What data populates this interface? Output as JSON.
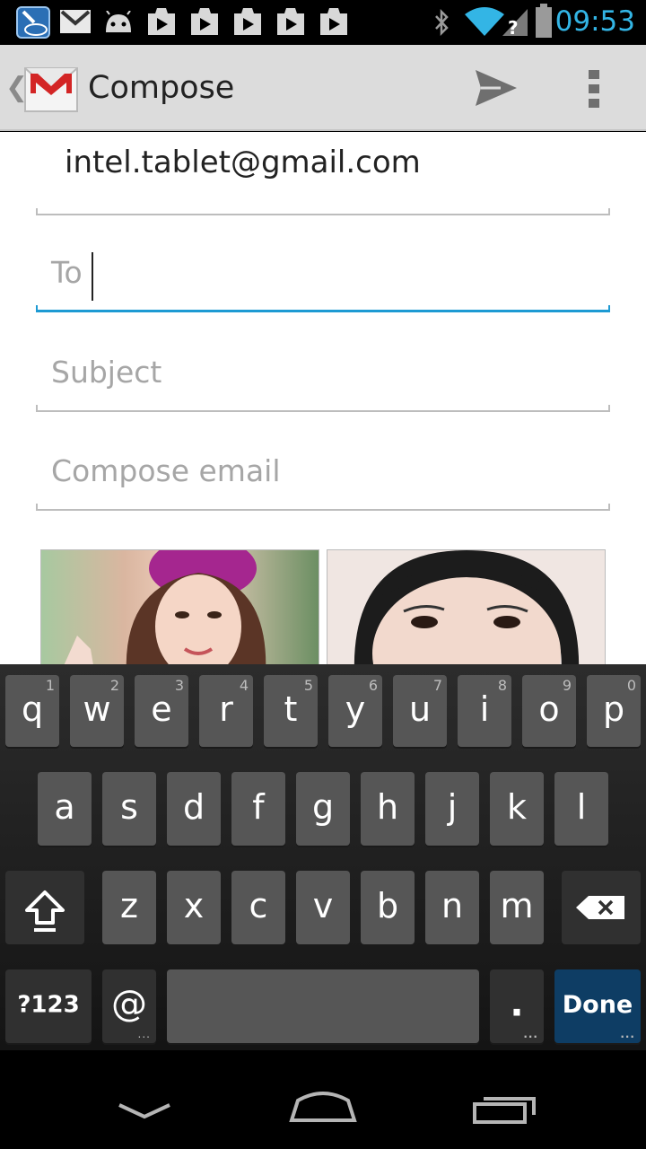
{
  "status_bar": {
    "time": "09:53",
    "icons": [
      "intel-app-icon",
      "gmail-icon",
      "android-icon",
      "play-store-icon",
      "play-store-icon",
      "play-store-icon",
      "play-store-icon",
      "play-store-icon",
      "bluetooth-icon",
      "wifi-icon",
      "no-signal-icon",
      "battery-icon"
    ],
    "accent_color": "#33b5e5"
  },
  "action_bar": {
    "title": "Compose",
    "app_icon": "gmail-logo-icon",
    "send_icon": "send-icon",
    "menu_icon": "overflow-menu-icon"
  },
  "compose": {
    "from": "intel.tablet@gmail.com",
    "to_placeholder": "To",
    "to_value": "",
    "subject_placeholder": "Subject",
    "body_placeholder": "Compose email",
    "focus_color": "#1d9ad3",
    "attachments": [
      "photo-attachment",
      "photo-attachment"
    ]
  },
  "keyboard": {
    "row1": [
      {
        "key": "q",
        "hint": "1"
      },
      {
        "key": "w",
        "hint": "2"
      },
      {
        "key": "e",
        "hint": "3"
      },
      {
        "key": "r",
        "hint": "4"
      },
      {
        "key": "t",
        "hint": "5"
      },
      {
        "key": "y",
        "hint": "6"
      },
      {
        "key": "u",
        "hint": "7"
      },
      {
        "key": "i",
        "hint": "8"
      },
      {
        "key": "o",
        "hint": "9"
      },
      {
        "key": "p",
        "hint": "0"
      }
    ],
    "row2": [
      "a",
      "s",
      "d",
      "f",
      "g",
      "h",
      "j",
      "k",
      "l"
    ],
    "row3": [
      "z",
      "x",
      "c",
      "v",
      "b",
      "n",
      "m"
    ],
    "symbols_label": "?123",
    "at_label": "@",
    "period_label": ".",
    "done_label": "Done",
    "shift_icon": "shift-icon",
    "delete_icon": "backspace-icon",
    "done_color": "#0e3d64"
  },
  "nav_bar": {
    "back_icon": "back-chevron-icon",
    "home_icon": "home-icon",
    "recents_icon": "recent-apps-icon"
  }
}
